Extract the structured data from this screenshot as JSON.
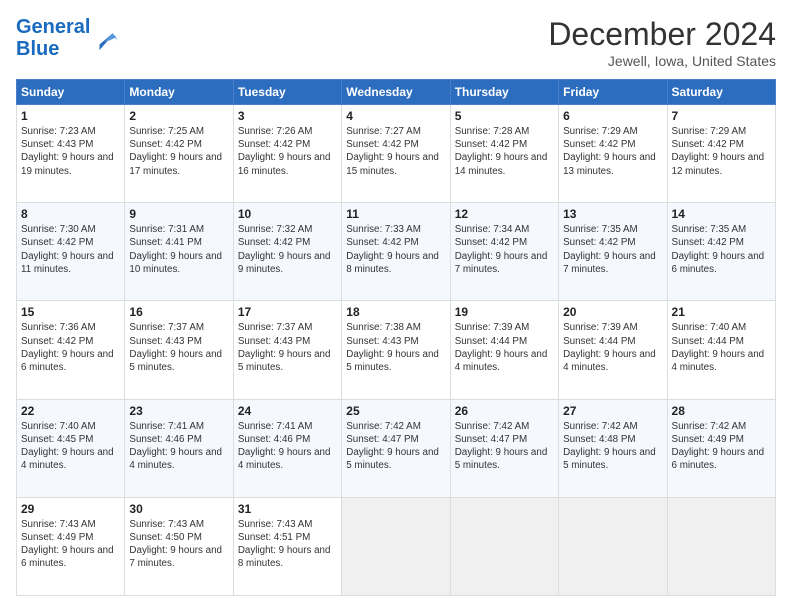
{
  "header": {
    "logo_line1": "General",
    "logo_line2": "Blue",
    "title": "December 2024",
    "subtitle": "Jewell, Iowa, United States"
  },
  "days_of_week": [
    "Sunday",
    "Monday",
    "Tuesday",
    "Wednesday",
    "Thursday",
    "Friday",
    "Saturday"
  ],
  "weeks": [
    [
      {
        "day": "1",
        "sunrise": "Sunrise: 7:23 AM",
        "sunset": "Sunset: 4:43 PM",
        "daylight": "Daylight: 9 hours and 19 minutes."
      },
      {
        "day": "2",
        "sunrise": "Sunrise: 7:25 AM",
        "sunset": "Sunset: 4:42 PM",
        "daylight": "Daylight: 9 hours and 17 minutes."
      },
      {
        "day": "3",
        "sunrise": "Sunrise: 7:26 AM",
        "sunset": "Sunset: 4:42 PM",
        "daylight": "Daylight: 9 hours and 16 minutes."
      },
      {
        "day": "4",
        "sunrise": "Sunrise: 7:27 AM",
        "sunset": "Sunset: 4:42 PM",
        "daylight": "Daylight: 9 hours and 15 minutes."
      },
      {
        "day": "5",
        "sunrise": "Sunrise: 7:28 AM",
        "sunset": "Sunset: 4:42 PM",
        "daylight": "Daylight: 9 hours and 14 minutes."
      },
      {
        "day": "6",
        "sunrise": "Sunrise: 7:29 AM",
        "sunset": "Sunset: 4:42 PM",
        "daylight": "Daylight: 9 hours and 13 minutes."
      },
      {
        "day": "7",
        "sunrise": "Sunrise: 7:29 AM",
        "sunset": "Sunset: 4:42 PM",
        "daylight": "Daylight: 9 hours and 12 minutes."
      }
    ],
    [
      {
        "day": "8",
        "sunrise": "Sunrise: 7:30 AM",
        "sunset": "Sunset: 4:42 PM",
        "daylight": "Daylight: 9 hours and 11 minutes."
      },
      {
        "day": "9",
        "sunrise": "Sunrise: 7:31 AM",
        "sunset": "Sunset: 4:41 PM",
        "daylight": "Daylight: 9 hours and 10 minutes."
      },
      {
        "day": "10",
        "sunrise": "Sunrise: 7:32 AM",
        "sunset": "Sunset: 4:42 PM",
        "daylight": "Daylight: 9 hours and 9 minutes."
      },
      {
        "day": "11",
        "sunrise": "Sunrise: 7:33 AM",
        "sunset": "Sunset: 4:42 PM",
        "daylight": "Daylight: 9 hours and 8 minutes."
      },
      {
        "day": "12",
        "sunrise": "Sunrise: 7:34 AM",
        "sunset": "Sunset: 4:42 PM",
        "daylight": "Daylight: 9 hours and 7 minutes."
      },
      {
        "day": "13",
        "sunrise": "Sunrise: 7:35 AM",
        "sunset": "Sunset: 4:42 PM",
        "daylight": "Daylight: 9 hours and 7 minutes."
      },
      {
        "day": "14",
        "sunrise": "Sunrise: 7:35 AM",
        "sunset": "Sunset: 4:42 PM",
        "daylight": "Daylight: 9 hours and 6 minutes."
      }
    ],
    [
      {
        "day": "15",
        "sunrise": "Sunrise: 7:36 AM",
        "sunset": "Sunset: 4:42 PM",
        "daylight": "Daylight: 9 hours and 6 minutes."
      },
      {
        "day": "16",
        "sunrise": "Sunrise: 7:37 AM",
        "sunset": "Sunset: 4:43 PM",
        "daylight": "Daylight: 9 hours and 5 minutes."
      },
      {
        "day": "17",
        "sunrise": "Sunrise: 7:37 AM",
        "sunset": "Sunset: 4:43 PM",
        "daylight": "Daylight: 9 hours and 5 minutes."
      },
      {
        "day": "18",
        "sunrise": "Sunrise: 7:38 AM",
        "sunset": "Sunset: 4:43 PM",
        "daylight": "Daylight: 9 hours and 5 minutes."
      },
      {
        "day": "19",
        "sunrise": "Sunrise: 7:39 AM",
        "sunset": "Sunset: 4:44 PM",
        "daylight": "Daylight: 9 hours and 4 minutes."
      },
      {
        "day": "20",
        "sunrise": "Sunrise: 7:39 AM",
        "sunset": "Sunset: 4:44 PM",
        "daylight": "Daylight: 9 hours and 4 minutes."
      },
      {
        "day": "21",
        "sunrise": "Sunrise: 7:40 AM",
        "sunset": "Sunset: 4:44 PM",
        "daylight": "Daylight: 9 hours and 4 minutes."
      }
    ],
    [
      {
        "day": "22",
        "sunrise": "Sunrise: 7:40 AM",
        "sunset": "Sunset: 4:45 PM",
        "daylight": "Daylight: 9 hours and 4 minutes."
      },
      {
        "day": "23",
        "sunrise": "Sunrise: 7:41 AM",
        "sunset": "Sunset: 4:46 PM",
        "daylight": "Daylight: 9 hours and 4 minutes."
      },
      {
        "day": "24",
        "sunrise": "Sunrise: 7:41 AM",
        "sunset": "Sunset: 4:46 PM",
        "daylight": "Daylight: 9 hours and 4 minutes."
      },
      {
        "day": "25",
        "sunrise": "Sunrise: 7:42 AM",
        "sunset": "Sunset: 4:47 PM",
        "daylight": "Daylight: 9 hours and 5 minutes."
      },
      {
        "day": "26",
        "sunrise": "Sunrise: 7:42 AM",
        "sunset": "Sunset: 4:47 PM",
        "daylight": "Daylight: 9 hours and 5 minutes."
      },
      {
        "day": "27",
        "sunrise": "Sunrise: 7:42 AM",
        "sunset": "Sunset: 4:48 PM",
        "daylight": "Daylight: 9 hours and 5 minutes."
      },
      {
        "day": "28",
        "sunrise": "Sunrise: 7:42 AM",
        "sunset": "Sunset: 4:49 PM",
        "daylight": "Daylight: 9 hours and 6 minutes."
      }
    ],
    [
      {
        "day": "29",
        "sunrise": "Sunrise: 7:43 AM",
        "sunset": "Sunset: 4:49 PM",
        "daylight": "Daylight: 9 hours and 6 minutes."
      },
      {
        "day": "30",
        "sunrise": "Sunrise: 7:43 AM",
        "sunset": "Sunset: 4:50 PM",
        "daylight": "Daylight: 9 hours and 7 minutes."
      },
      {
        "day": "31",
        "sunrise": "Sunrise: 7:43 AM",
        "sunset": "Sunset: 4:51 PM",
        "daylight": "Daylight: 9 hours and 8 minutes."
      },
      null,
      null,
      null,
      null
    ]
  ]
}
